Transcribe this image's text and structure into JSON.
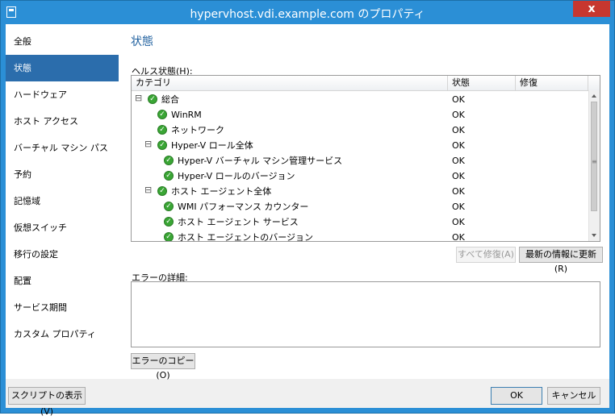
{
  "window": {
    "title": "hypervhost.vdi.example.com のプロパティ",
    "close_label": "x"
  },
  "sidebar": {
    "items": [
      {
        "label": "全般",
        "active": false
      },
      {
        "label": "状態",
        "active": true
      },
      {
        "label": "ハードウェア",
        "active": false
      },
      {
        "label": "ホスト アクセス",
        "active": false
      },
      {
        "label": "バーチャル マシン パス",
        "active": false
      },
      {
        "label": "予約",
        "active": false
      },
      {
        "label": "記憶域",
        "active": false
      },
      {
        "label": "仮想スイッチ",
        "active": false
      },
      {
        "label": "移行の設定",
        "active": false
      },
      {
        "label": "配置",
        "active": false
      },
      {
        "label": "サービス期間",
        "active": false
      },
      {
        "label": "カスタム プロパティ",
        "active": false
      }
    ]
  },
  "main": {
    "title": "状態",
    "health_label": "ヘルス状態(H):",
    "grid": {
      "columns": [
        "カテゴリ",
        "状態",
        "修復"
      ],
      "rows": [
        {
          "name": "総合",
          "status": "OK",
          "expander": "⊟",
          "level": 0
        },
        {
          "name": "WinRM",
          "status": "OK",
          "expander": "",
          "level": 1
        },
        {
          "name": "ネットワーク",
          "status": "OK",
          "expander": "",
          "level": 1
        },
        {
          "name": "Hyper-V ロール全体",
          "status": "OK",
          "expander": "⊟",
          "level": 1
        },
        {
          "name": "Hyper-V バーチャル マシン管理サービス",
          "status": "OK",
          "expander": "",
          "level": 2
        },
        {
          "name": "Hyper-V ロールのバージョン",
          "status": "OK",
          "expander": "",
          "level": 2
        },
        {
          "name": "ホスト エージェント全体",
          "status": "OK",
          "expander": "⊟",
          "level": 1
        },
        {
          "name": "WMI パフォーマンス カウンター",
          "status": "OK",
          "expander": "",
          "level": 2
        },
        {
          "name": "ホスト エージェント サービス",
          "status": "OK",
          "expander": "",
          "level": 2
        },
        {
          "name": "ホスト エージェントのバージョン",
          "status": "OK",
          "expander": "",
          "level": 2
        }
      ]
    },
    "repair_all_label": "すべて修復(A)",
    "refresh_label": "最新の情報に更新(R)",
    "errors_label": "エラーの詳細:",
    "errors_text": "",
    "copy_errors_label": "エラーのコピー(O)"
  },
  "footer": {
    "view_script_label": "スクリプトの表示(V)",
    "ok_label": "OK",
    "cancel_label": "キャンセル"
  }
}
